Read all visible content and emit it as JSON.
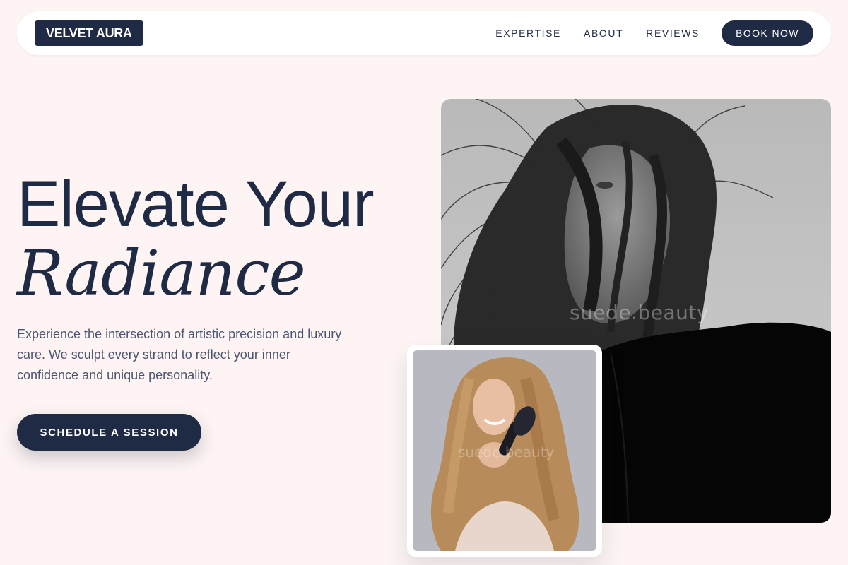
{
  "brand": {
    "name": "VELVET AURA"
  },
  "nav": {
    "links": [
      "EXPERTISE",
      "ABOUT",
      "REVIEWS"
    ],
    "book_label": "BOOK NOW"
  },
  "hero": {
    "title_line1": "Elevate Your",
    "title_line2": "Radiance",
    "description": "Experience the intersection of artistic precision and luxury care. We sculpt every strand to reflect your inner confidence and unique personality.",
    "cta_label": "SCHEDULE A SESSION"
  },
  "images": {
    "main_watermark": "suede.beauty",
    "small_watermark": "suede.beauty"
  },
  "colors": {
    "background": "#fdf4f3",
    "primary": "#1f2a44",
    "text_muted": "#4b5470"
  }
}
